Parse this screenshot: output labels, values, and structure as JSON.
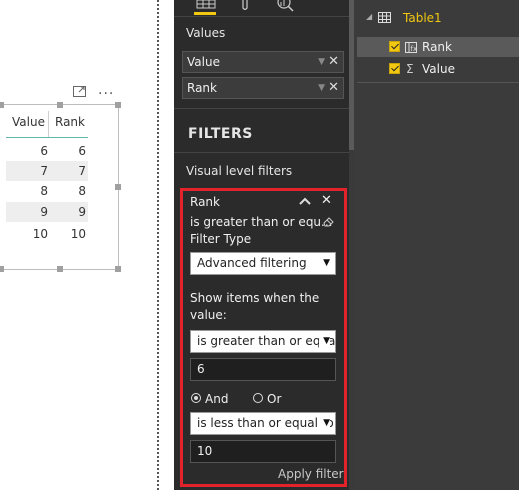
{
  "visual": {
    "header_icons": [
      "focus-mode-icon",
      "more-options-icon"
    ],
    "more_options": "...",
    "columns": [
      "Value",
      "Rank"
    ],
    "rows": [
      {
        "value": "6",
        "rank": "6"
      },
      {
        "value": "7",
        "rank": "7"
      },
      {
        "value": "8",
        "rank": "8"
      },
      {
        "value": "9",
        "rank": "9"
      },
      {
        "value": "10",
        "rank": "10"
      }
    ]
  },
  "viz_pane": {
    "tab_icons": [
      "fields-tab-icon",
      "format-tab-icon",
      "analytics-tab-icon"
    ],
    "values_label": "Values",
    "wells": [
      {
        "label": "Value",
        "remove": "✕"
      },
      {
        "label": "Rank",
        "remove": "✕"
      }
    ],
    "filters_title": "FILTERS",
    "visual_level_label": "Visual level filters",
    "filter_card": {
      "field": "Rank",
      "summary": "is greater than or equ...",
      "filter_type_label": "Filter Type",
      "filter_type_value": "Advanced filtering",
      "show_items_label_1": "Show items when the",
      "show_items_label_2": "value:",
      "condition1_op": "is greater than or equal to",
      "condition1_value": "6",
      "and_label": "And",
      "or_label": "Or",
      "logic_selected": "And",
      "condition2_op": "is less than or equal to",
      "condition2_value": "10",
      "apply_label": "Apply filter"
    }
  },
  "fields_pane": {
    "table_name": "Table1",
    "fields": [
      {
        "name": "Rank",
        "checked": true,
        "icon": "calculated-column-icon"
      },
      {
        "name": "Value",
        "checked": true,
        "icon": "sigma-icon"
      }
    ]
  },
  "colors": {
    "accent": "#f2c811",
    "highlight_border": "#e3232b",
    "pane_bg": "#2b2b2b",
    "fields_bg": "#3b3b3b",
    "header_line": "#5fb8b0"
  }
}
